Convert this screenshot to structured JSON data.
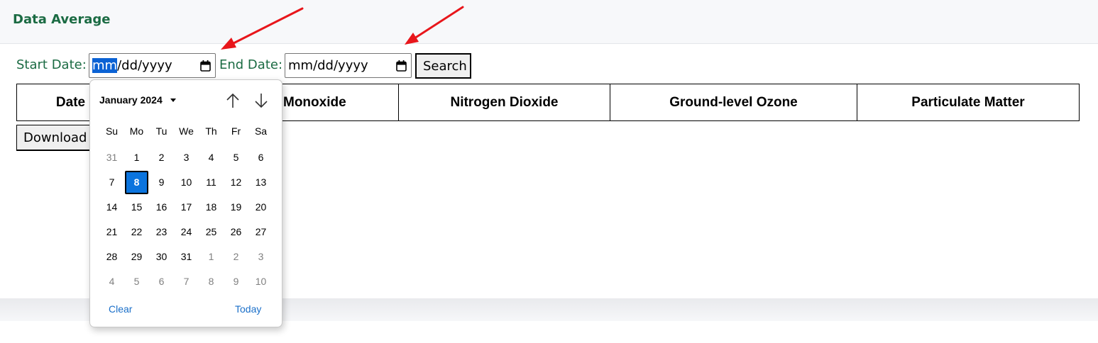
{
  "header": {
    "title": "Data Average"
  },
  "filters": {
    "start_label": "Start Date:",
    "start_segments": [
      "mm",
      "/dd/yyyy"
    ],
    "end_label": "End Date:",
    "end_value": "mm/dd/yyyy",
    "search_label": "Search"
  },
  "table": {
    "columns": [
      "Date",
      "Carbon Monoxide",
      "Nitrogen Dioxide",
      "Ground-level Ozone",
      "Particulate Matter"
    ],
    "visible_headers": [
      "Date",
      "Monoxide",
      "Nitrogen Dioxide",
      "Ground-level Ozone",
      "Particulate Matter"
    ]
  },
  "download_label": "Download",
  "calendar": {
    "month_label": "January 2024",
    "weekdays": [
      "Su",
      "Mo",
      "Tu",
      "We",
      "Th",
      "Fr",
      "Sa"
    ],
    "weeks": [
      [
        "31",
        "1",
        "2",
        "3",
        "4",
        "5",
        "6"
      ],
      [
        "7",
        "8",
        "9",
        "10",
        "11",
        "12",
        "13"
      ],
      [
        "14",
        "15",
        "16",
        "17",
        "18",
        "19",
        "20"
      ],
      [
        "21",
        "22",
        "23",
        "24",
        "25",
        "26",
        "27"
      ],
      [
        "28",
        "29",
        "30",
        "31",
        "1",
        "2",
        "3"
      ],
      [
        "4",
        "5",
        "6",
        "7",
        "8",
        "9",
        "10"
      ]
    ],
    "selected_day": "8",
    "clear_label": "Clear",
    "today_label": "Today"
  },
  "colors": {
    "accent_green": "#1b6b43",
    "selection_blue": "#0b74de",
    "link_blue": "#1a6fc9",
    "arrow_red": "#e8161b"
  },
  "icons": [
    "calendar-icon",
    "arrow-up-icon",
    "arrow-down-icon",
    "caret-down-icon"
  ]
}
